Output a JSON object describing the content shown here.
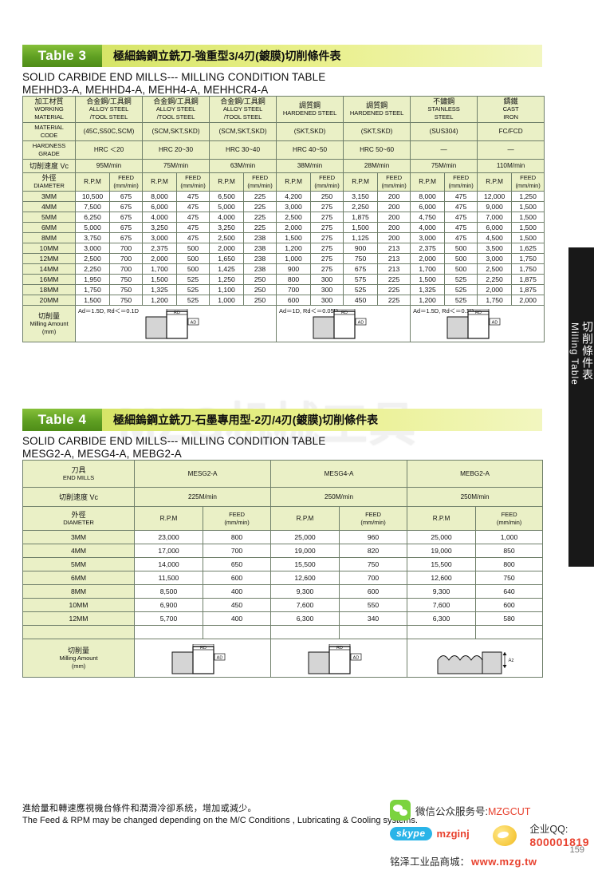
{
  "table3": {
    "badge": "Table 3",
    "title_cn": "極細鎢鋼立銑刀-強重型3/4刃(鍍膜)切削條件表",
    "subtitle_en": "SOLID CARBIDE END MILLS--- MILLING CONDITION TABLE",
    "models": "MEHHD3-A, MEHHD4-A, MEHH4-A, MEHHCR4-A",
    "row_labels": {
      "working_material_cn": "加工材質",
      "working_material_en1": "WORKING",
      "working_material_en2": "MATERIAL",
      "material_code_en1": "MATERIAL",
      "material_code_en2": "CODE",
      "hardness_en1": "HARDNESS",
      "hardness_en2": "GRADE",
      "speed_cn": "切削速度 Vc",
      "diameter_cn": "外徑",
      "diameter_en": "DIAMETER",
      "milling_amount_cn": "切削量",
      "milling_amount_en": "Milling Amount",
      "milling_amount_unit": "(mm)"
    },
    "columns": [
      {
        "material_cn": "合金鋼/工具鋼",
        "material_en1": "ALLOY STEEL",
        "material_en2": "/TOOL STEEL",
        "code": "(45C,S50C,SCM)",
        "hardness": "HRC ＜20",
        "speed": "95M/min"
      },
      {
        "material_cn": "合金鋼/工具鋼",
        "material_en1": "ALLOY STEEL",
        "material_en2": "/TOOL STEEL",
        "code": "(SCM,SKT,SKD)",
        "hardness": "HRC 20~30",
        "speed": "75M/min"
      },
      {
        "material_cn": "合金鋼/工具鋼",
        "material_en1": "ALLOY STEEL",
        "material_en2": "/TOOL STEEL",
        "code": "(SCM,SKT,SKD)",
        "hardness": "HRC 30~40",
        "speed": "63M/min"
      },
      {
        "material_cn": "調質鋼",
        "material_en1": "HARDENED STEEL",
        "material_en2": "",
        "code": "(SKT,SKD)",
        "hardness": "HRC 40~50",
        "speed": "38M/min"
      },
      {
        "material_cn": "調質鋼",
        "material_en1": "HARDENED STEEL",
        "material_en2": "",
        "code": "(SKT,SKD)",
        "hardness": "HRC 50~60",
        "speed": "28M/min"
      },
      {
        "material_cn": "不鏽鋼",
        "material_en1": "STAINLESS",
        "material_en2": "STEEL",
        "code": "(SUS304)",
        "hardness": "—",
        "speed": "75M/min"
      },
      {
        "material_cn": "鑄鐵",
        "material_en1": "CAST",
        "material_en2": "IRON",
        "code": "FC/FCD",
        "hardness": "—",
        "speed": "110M/min"
      }
    ],
    "subheaders": {
      "rpm": "R.P.M",
      "feed": "FEED",
      "feed_unit": "(mm/min)"
    },
    "rows": [
      {
        "dia": "3MM",
        "v": [
          "10,500",
          "675",
          "8,000",
          "475",
          "6,500",
          "225",
          "4,200",
          "250",
          "3,150",
          "200",
          "8,000",
          "475",
          "12,000",
          "1,250"
        ]
      },
      {
        "dia": "4MM",
        "v": [
          "7,500",
          "675",
          "6,000",
          "475",
          "5,000",
          "225",
          "3,000",
          "275",
          "2,250",
          "200",
          "6,000",
          "475",
          "9,000",
          "1,500"
        ]
      },
      {
        "dia": "5MM",
        "v": [
          "6,250",
          "675",
          "4,000",
          "475",
          "4,000",
          "225",
          "2,500",
          "275",
          "1,875",
          "200",
          "4,750",
          "475",
          "7,000",
          "1,500"
        ]
      },
      {
        "dia": "6MM",
        "v": [
          "5,000",
          "675",
          "3,250",
          "475",
          "3,250",
          "225",
          "2,000",
          "275",
          "1,500",
          "200",
          "4,000",
          "475",
          "6,000",
          "1,500"
        ]
      },
      {
        "dia": "8MM",
        "v": [
          "3,750",
          "675",
          "3,000",
          "475",
          "2,500",
          "238",
          "1,500",
          "275",
          "1,125",
          "200",
          "3,000",
          "475",
          "4,500",
          "1,500"
        ]
      },
      {
        "dia": "10MM",
        "v": [
          "3,000",
          "700",
          "2,375",
          "500",
          "2,000",
          "238",
          "1,200",
          "275",
          "900",
          "213",
          "2,375",
          "500",
          "3,500",
          "1,625"
        ]
      },
      {
        "dia": "12MM",
        "v": [
          "2,500",
          "700",
          "2,000",
          "500",
          "1,650",
          "238",
          "1,000",
          "275",
          "750",
          "213",
          "2,000",
          "500",
          "3,000",
          "1,750"
        ]
      },
      {
        "dia": "14MM",
        "v": [
          "2,250",
          "700",
          "1,700",
          "500",
          "1,425",
          "238",
          "900",
          "275",
          "675",
          "213",
          "1,700",
          "500",
          "2,500",
          "1,750"
        ]
      },
      {
        "dia": "16MM",
        "v": [
          "1,950",
          "750",
          "1,500",
          "525",
          "1,250",
          "250",
          "800",
          "300",
          "575",
          "225",
          "1,500",
          "525",
          "2,250",
          "1,875"
        ]
      },
      {
        "dia": "18MM",
        "v": [
          "1,750",
          "750",
          "1,325",
          "525",
          "1,100",
          "250",
          "700",
          "300",
          "525",
          "225",
          "1,325",
          "525",
          "2,000",
          "1,875"
        ]
      },
      {
        "dia": "20MM",
        "v": [
          "1,500",
          "750",
          "1,200",
          "525",
          "1,000",
          "250",
          "600",
          "300",
          "450",
          "225",
          "1,200",
          "525",
          "1,750",
          "2,000"
        ]
      }
    ],
    "diagrams": [
      {
        "note": "Ad＝1.5D, Rd＜＝0.1D",
        "rd": "RD",
        "ad": "AD"
      },
      {
        "note": "Ad＝1D, Rd＜＝0.05D",
        "rd": "RD",
        "ad": "AD"
      },
      {
        "note": "Ad＝1.5D, Rd＜＝0.1D",
        "rd": "RD",
        "ad": "AD"
      }
    ]
  },
  "table4": {
    "badge": "Table 4",
    "title_cn": "極細鎢鋼立銑刀-石墨專用型-2刃/4刃(鍍膜)切削條件表",
    "subtitle_en": "SOLID CARBIDE END MILLS--- MILLING CONDITION TABLE",
    "models": "MESG2-A, MESG4-A, MEBG2-A",
    "row_labels": {
      "endmill_cn": "刀具",
      "endmill_en": "END MILLS",
      "speed_cn": "切削速度 Vc",
      "diameter_cn": "外徑",
      "diameter_en": "DIAMETER",
      "milling_amount_cn": "切削量",
      "milling_amount_en": "Milling Amount",
      "milling_amount_unit": "(mm)"
    },
    "columns": [
      {
        "name": "MESG2-A",
        "speed": "225M/min"
      },
      {
        "name": "MESG4-A",
        "speed": "250M/min"
      },
      {
        "name": "MEBG2-A",
        "speed": "250M/min"
      }
    ],
    "subheaders": {
      "rpm": "R.P.M",
      "feed": "FEED",
      "feed_unit": "(mm/min)"
    },
    "rows": [
      {
        "dia": "3MM",
        "v": [
          "23,000",
          "800",
          "25,000",
          "960",
          "25,000",
          "1,000"
        ]
      },
      {
        "dia": "4MM",
        "v": [
          "17,000",
          "700",
          "19,000",
          "820",
          "19,000",
          "850"
        ]
      },
      {
        "dia": "5MM",
        "v": [
          "14,000",
          "650",
          "15,500",
          "750",
          "15,500",
          "800"
        ]
      },
      {
        "dia": "6MM",
        "v": [
          "11,500",
          "600",
          "12,600",
          "700",
          "12,600",
          "750"
        ]
      },
      {
        "dia": "8MM",
        "v": [
          "8,500",
          "400",
          "9,300",
          "600",
          "9,300",
          "640"
        ]
      },
      {
        "dia": "10MM",
        "v": [
          "6,900",
          "450",
          "7,600",
          "550",
          "7,600",
          "600"
        ]
      },
      {
        "dia": "12MM",
        "v": [
          "5,700",
          "400",
          "6,300",
          "340",
          "6,300",
          "580"
        ]
      },
      {
        "dia": "",
        "v": [
          "",
          "",
          "",
          "",
          "",
          ""
        ]
      }
    ],
    "diagrams": [
      {
        "note": "",
        "rd": "RD",
        "ad": "AD"
      },
      {
        "note": "",
        "rd": "RD",
        "ad": "AD"
      },
      {
        "note": "",
        "rd": "",
        "ad": "Az"
      }
    ]
  },
  "side_tab": {
    "cn": "切削條件表",
    "en": "Milling Table"
  },
  "watermark": "MZG机械工具",
  "footer": {
    "cn": "進給量和轉速應視機台條件和潤滑冷卻系統，增加或減少。",
    "en": "The Feed & RPM may be changed depending on the M/C Conditions , Lubricating & Cooling systems."
  },
  "contact": {
    "wechat_label": "微信公众服务号:",
    "wechat_id": "MZGCUT",
    "skype_label": "skype",
    "skype_id": "mzginj",
    "qq_label": "企业QQ:",
    "qq_number": "800001819",
    "mall_label": "铭泽工业品商城：",
    "mall_url": "www.mzg.tw"
  },
  "page_number": "159",
  "colors": {
    "badge_green": "#5f9f22",
    "banner_lime": "#cfe05a",
    "header_fill": "#eaf0c6",
    "accent_red": "#e8422f",
    "skype_blue": "#29b4e8"
  }
}
